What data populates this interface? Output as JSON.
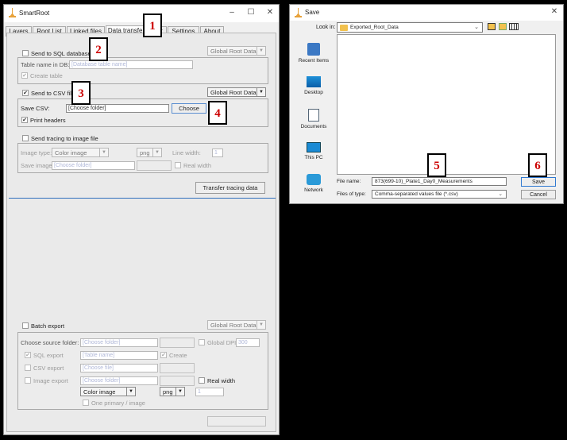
{
  "left_window": {
    "title": "SmartRoot",
    "controls": {
      "minimize": "–",
      "maximize": "☐",
      "close": "✕"
    },
    "tabs": [
      "Layers",
      "Root List",
      "Linked files",
      "Data transfer",
      "Plot",
      "Settings",
      "About"
    ],
    "sql": {
      "checkbox_label": "Send to SQL database",
      "global_combo": "Global Root Data",
      "table_label": "Table name in DB:",
      "table_placeholder": "[Database table name]",
      "create_table": "Create table"
    },
    "csv": {
      "checkbox_label": "Send to CSV file",
      "checked": "✔",
      "global_combo": "Global Root Data",
      "save_label": "Save CSV:",
      "save_value": "[Choose folder]",
      "choose_button": "Choose",
      "print_headers": "Print headers"
    },
    "image": {
      "checkbox_label": "Send tracing to image file",
      "type_label": "Image type:",
      "type_value": "Color image",
      "format_value": "png",
      "line_width_label": "Line width:",
      "line_width_value": "1",
      "save_label": "Save image:",
      "save_placeholder": "[Choose folder]",
      "real_width": "Real width",
      "transfer_button": "Transfer tracing data"
    },
    "batch": {
      "checkbox_label": "Batch export",
      "global_combo": "Global Root Data",
      "source_label": "Choose source folder:",
      "source_placeholder": "[Choose folder]",
      "global_dpi_label": "Global DPI:",
      "global_dpi_value": "300",
      "sql_export": "SQL export",
      "sql_placeholder": "[Table name]",
      "create": "Create",
      "csv_export": "CSV export",
      "csv_placeholder": "[Choose file]",
      "image_export": "Image export",
      "image_placeholder": "[Choose folder]",
      "real_width": "Real width",
      "type_value": "Color image",
      "format_value": "png",
      "width_value": "1",
      "one_primary": "One primary / image"
    }
  },
  "save_dialog": {
    "title": "Save",
    "close": "✕",
    "look_in_label": "Look in:",
    "look_in_value": "Exported_Root_Data",
    "places": [
      "Recent Items",
      "Desktop",
      "Documents",
      "This PC",
      "Network"
    ],
    "file_name_label": "File name:",
    "file_name_value": "873(699-10)_Plate1_Day0_Measurements",
    "file_type_label": "Files of type:",
    "file_type_value": "Comma-separated values file (*.csv)",
    "save_button": "Save",
    "cancel_button": "Cancel"
  },
  "annotations": [
    "1",
    "2",
    "3",
    "4",
    "5",
    "6"
  ],
  "colors": {
    "annotation_text": "#cc0000",
    "folder": "#f2c14e",
    "separator": "#2f6fbd",
    "app_icon": "#e8a23a"
  }
}
